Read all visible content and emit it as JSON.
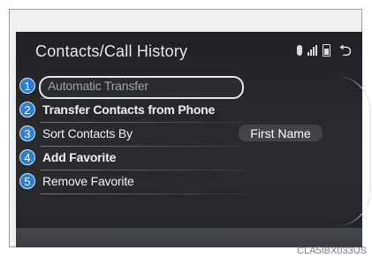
{
  "header": {
    "title": "Contacts/Call History",
    "status_icons": [
      "bluetooth-icon",
      "signal-icon",
      "battery-icon"
    ],
    "back_icon": "back-arrow-icon"
  },
  "menu": {
    "items": [
      {
        "number": "1",
        "label": "Automatic Transfer",
        "state": "selected"
      },
      {
        "number": "2",
        "label": "Transfer Contacts from Phone"
      },
      {
        "number": "3",
        "label": "Sort Contacts By",
        "value": "First Name"
      },
      {
        "number": "4",
        "label": "Add Favorite"
      },
      {
        "number": "5",
        "label": "Remove Favorite"
      }
    ]
  },
  "caption": "CLA5IBX033US"
}
